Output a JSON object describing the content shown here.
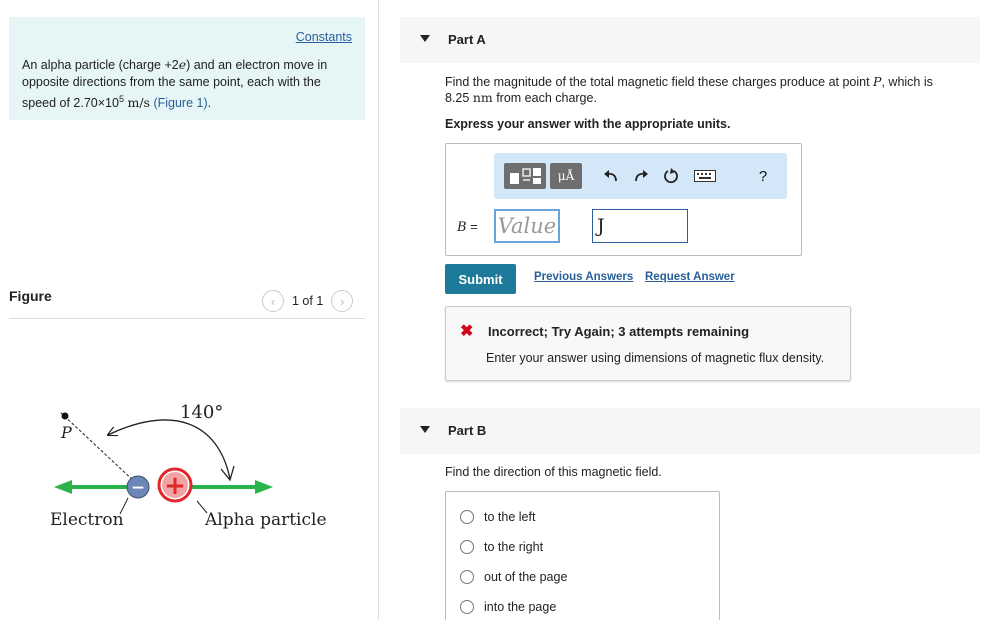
{
  "problem": {
    "constants_link": "Constants",
    "line1": "An alpha particle (charge +2",
    "line1_var": "e",
    "line1_end": ") and an electron move in",
    "line2": "opposite directions from the same point, each with the",
    "line3_pre": "speed of 2.70×10",
    "line3_exp": "5",
    "line3_unit": "m/s",
    "line3_link": "(Figure 1)",
    "line3_end": "."
  },
  "figure": {
    "title": "Figure",
    "pager": "1 of 1",
    "prev_icon": "chevron-left-icon",
    "next_icon": "chevron-right-icon",
    "angle_label": "140°",
    "point_label": "P",
    "electron_label": "Electron",
    "alpha_label": "Alpha particle",
    "electron_sign": "−",
    "alpha_sign": "+",
    "colors": {
      "arrow": "#29b34a",
      "alpha": "#e2262a",
      "electron": "#6c86b8"
    }
  },
  "partA": {
    "label": "Part A",
    "question_pre": "Find the magnitude of the total magnetic field these charges produce at point ",
    "question_var": "P",
    "question_mid": ", which is",
    "question_line2_pre": "8.25 ",
    "question_unit": "nm",
    "question_line2_end": " from each charge.",
    "instruction": "Express your answer with the appropriate units.",
    "toolbar": {
      "units_button": "μÅ",
      "help": "?",
      "icons": [
        "templates-icon",
        "units-icon",
        "undo-icon",
        "redo-icon",
        "reset-icon",
        "keyboard-icon",
        "help-icon"
      ]
    },
    "var_label": "B",
    "equals": " =",
    "value_placeholder": "Value",
    "unit_value": "J",
    "submit": "Submit",
    "previous_answers": "Previous Answers",
    "request_answer": "Request Answer",
    "feedback_title": "Incorrect; Try Again; 3 attempts remaining",
    "feedback_body": "Enter your answer using dimensions of magnetic flux density.",
    "feedback_icon": "x-mark-icon",
    "feedback_color": "#d0021b"
  },
  "partB": {
    "label": "Part B",
    "question": "Find the direction of this magnetic field.",
    "options": [
      "to the left",
      "to the right",
      "out of the page",
      "into the page"
    ]
  },
  "colors": {
    "accent": "#1e7a9a",
    "link": "#2a5f99",
    "problem_bg": "#e6f5f6",
    "toolbar_bg": "#d3e7f8"
  }
}
